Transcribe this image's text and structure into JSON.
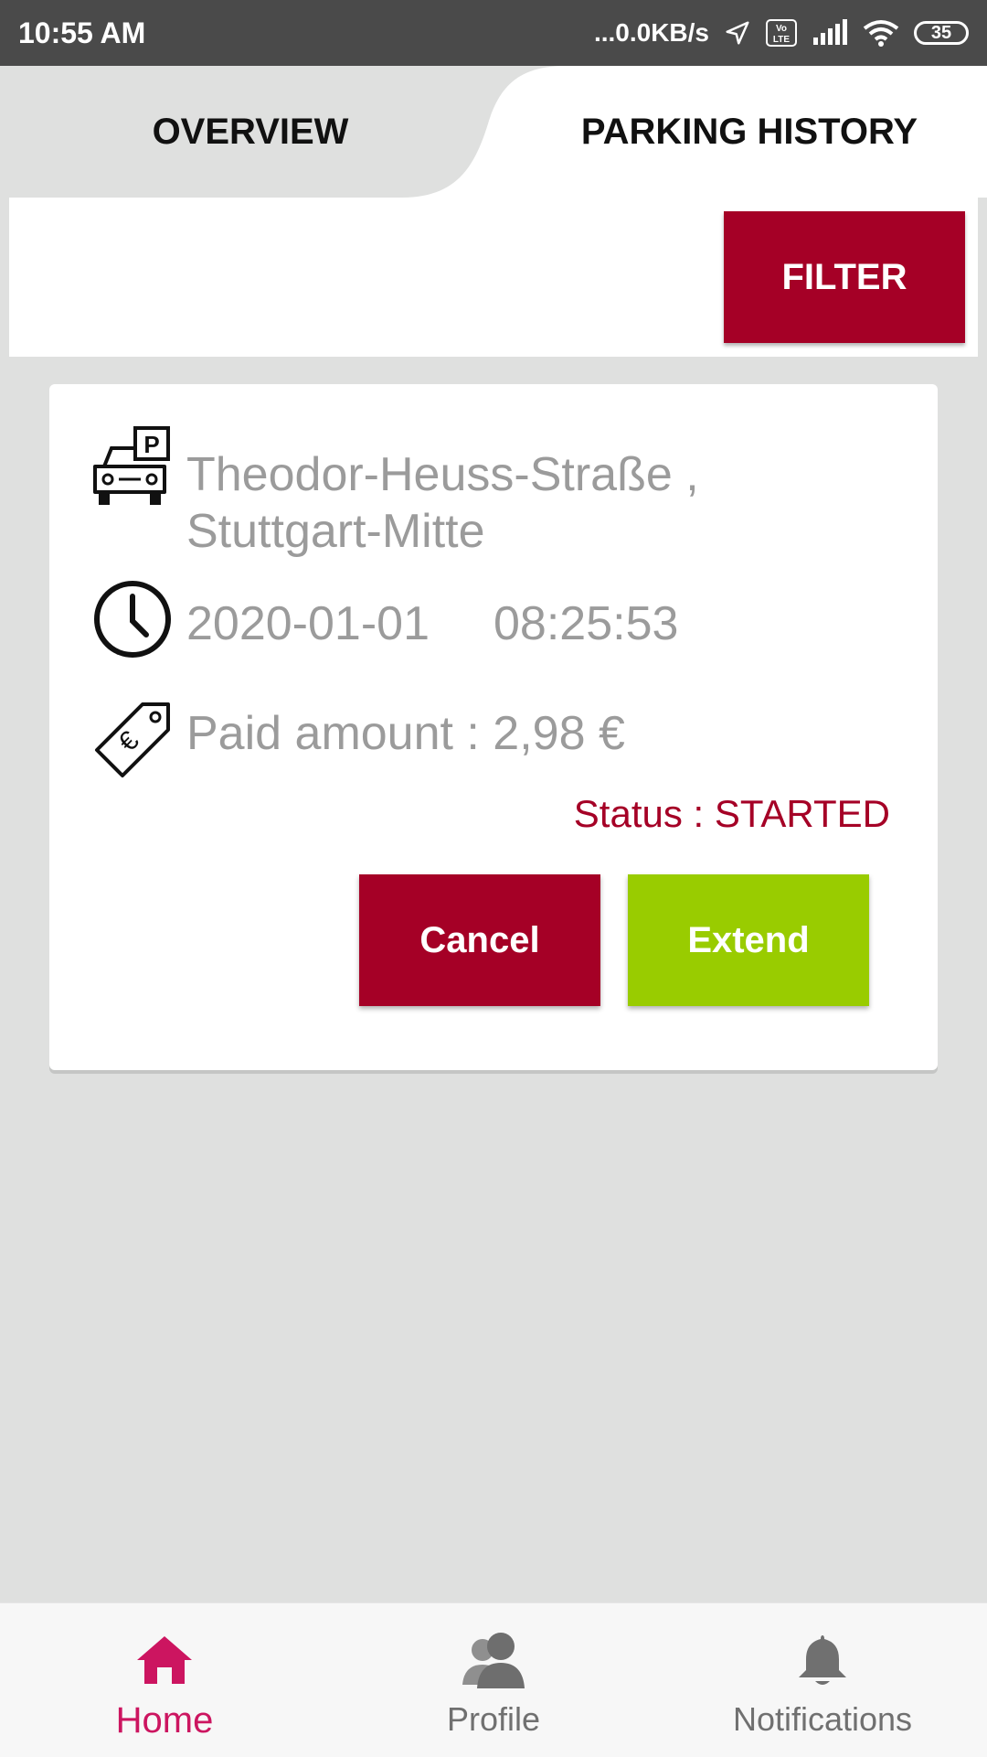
{
  "status_bar": {
    "time": "10:55 AM",
    "network_speed": "...0.0KB/s",
    "battery_level": "35",
    "icons": [
      "location-icon",
      "volte-icon",
      "signal-icon",
      "wifi-icon",
      "battery-icon"
    ]
  },
  "tabs": {
    "overview_label": "OVERVIEW",
    "history_label": "PARKING HISTORY",
    "active": "PARKING HISTORY"
  },
  "filter": {
    "label": "FILTER"
  },
  "parking_card": {
    "address": "Theodor-Heuss-Straße , Stuttgart-Mitte",
    "date": "2020-01-01",
    "time": "08:25:53",
    "paid_amount": "Paid amount : 2,98 €",
    "status": "Status : STARTED",
    "cancel_label": "Cancel",
    "extend_label": "Extend",
    "icons": [
      "car-parking-icon",
      "clock-icon",
      "euro-tag-icon"
    ]
  },
  "bottom_nav": {
    "items": [
      {
        "label": "Home",
        "icon": "home-icon",
        "active": true
      },
      {
        "label": "Profile",
        "icon": "profile-icon",
        "active": false
      },
      {
        "label": "Notifications",
        "icon": "bell-icon",
        "active": false
      }
    ]
  },
  "colors": {
    "primary": "#a50026",
    "extend_green": "#99cc00",
    "nav_active": "#cc1560",
    "background": "#dfe0df"
  }
}
